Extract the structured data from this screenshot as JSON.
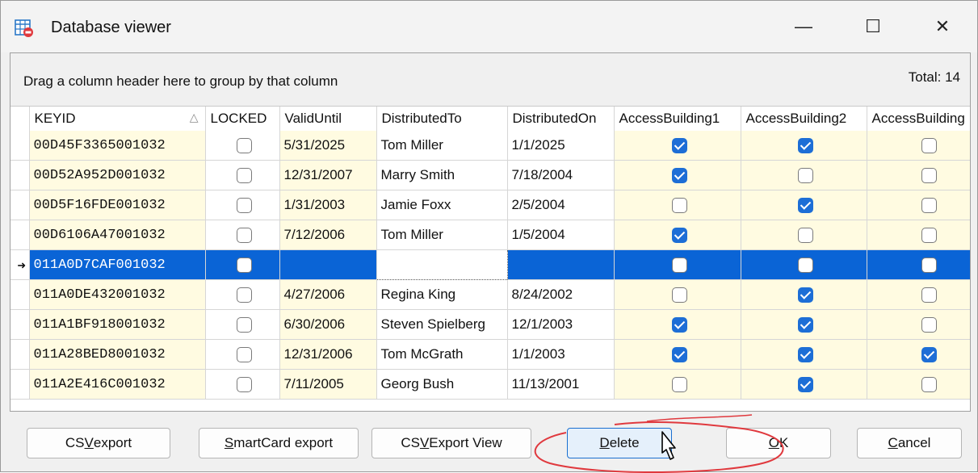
{
  "window": {
    "title": "Database viewer",
    "minimize_glyph": "—",
    "maximize_glyph": "☐",
    "close_glyph": "✕",
    "icon": "database-table-icon"
  },
  "group_panel": {
    "hint": "Drag a column header here to group by that column",
    "total": "Total: 14"
  },
  "grid": {
    "columns": [
      "KEYID",
      "LOCKED",
      "ValidUntil",
      "DistributedTo",
      "DistributedOn",
      "AccessBuilding1",
      "AccessBuilding2",
      "AccessBuilding"
    ],
    "sort_icon": "△",
    "current_row_marker": "➜",
    "rows": [
      {
        "keyid": "00D45F3365001032",
        "locked": false,
        "valid_until": "5/31/2025",
        "distributed_to": "Tom Miller",
        "distributed_on": "1/1/2025",
        "ab1": true,
        "ab2": true,
        "ab3": false
      },
      {
        "keyid": "00D52A952D001032",
        "locked": false,
        "valid_until": "12/31/2007",
        "distributed_to": "Marry Smith",
        "distributed_on": "7/18/2004",
        "ab1": true,
        "ab2": false,
        "ab3": false
      },
      {
        "keyid": "00D5F16FDE001032",
        "locked": false,
        "valid_until": "1/31/2003",
        "distributed_to": "Jamie Foxx",
        "distributed_on": "2/5/2004",
        "ab1": false,
        "ab2": true,
        "ab3": false
      },
      {
        "keyid": "00D6106A47001032",
        "locked": false,
        "valid_until": "7/12/2006",
        "distributed_to": "Tom Miller",
        "distributed_on": "1/5/2004",
        "ab1": true,
        "ab2": false,
        "ab3": false
      },
      {
        "keyid": "011A0D7CAF001032",
        "locked": false,
        "valid_until": "",
        "distributed_to": "",
        "distributed_on": "",
        "ab1": false,
        "ab2": false,
        "ab3": false,
        "selected": true
      },
      {
        "keyid": "011A0DE432001032",
        "locked": false,
        "valid_until": "4/27/2006",
        "distributed_to": "Regina King",
        "distributed_on": "8/24/2002",
        "ab1": false,
        "ab2": true,
        "ab3": false
      },
      {
        "keyid": "011A1BF918001032",
        "locked": false,
        "valid_until": "6/30/2006",
        "distributed_to": "Steven Spielberg",
        "distributed_on": "12/1/2003",
        "ab1": true,
        "ab2": true,
        "ab3": false
      },
      {
        "keyid": "011A28BED8001032",
        "locked": false,
        "valid_until": "12/31/2006",
        "distributed_to": "Tom McGrath",
        "distributed_on": "1/1/2003",
        "ab1": true,
        "ab2": true,
        "ab3": true
      },
      {
        "keyid": "011A2E416C001032",
        "locked": false,
        "valid_until": "7/11/2005",
        "distributed_to": "Georg Bush",
        "distributed_on": "11/13/2001",
        "ab1": false,
        "ab2": true,
        "ab3": false
      }
    ]
  },
  "buttons": {
    "csv_export": {
      "pre": "CS",
      "u": "V",
      "post": " export"
    },
    "smartcard_export": {
      "pre": "",
      "u": "S",
      "post": "martCard export"
    },
    "csv_export_view": {
      "pre": "CS",
      "u": "V",
      "post": " Export View"
    },
    "delete": {
      "pre": "",
      "u": "D",
      "post": "elete"
    },
    "ok": {
      "pre": "",
      "u": "O",
      "post": "K"
    },
    "cancel": {
      "pre": "",
      "u": "C",
      "post": "ancel"
    }
  },
  "colors": {
    "selection": "#0a64d6",
    "key_cell_bg": "#fffbe1",
    "checkbox_on": "#1d6ed6",
    "annotation": "#e0393e"
  }
}
